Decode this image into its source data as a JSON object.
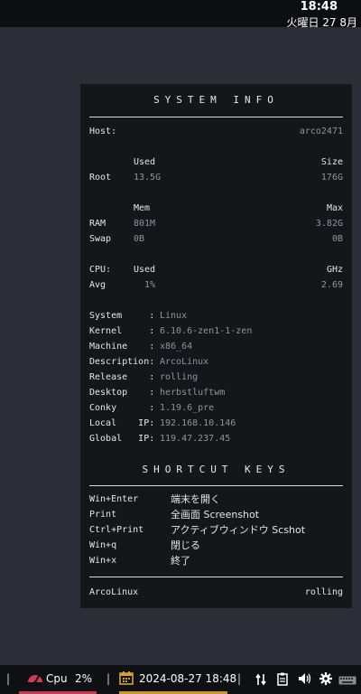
{
  "topbar": {
    "time": "18:48",
    "date": "火曜日 27 8月"
  },
  "conky": {
    "system_title": "SYSTEM INFO",
    "host_label": "Host:",
    "host_value": "arco2471",
    "disk": {
      "used_header": "Used",
      "size_header": "Size",
      "label": "Root",
      "used": "13.5G",
      "size": "176G"
    },
    "mem": {
      "mem_header": "Mem",
      "max_header": "Max",
      "ram_label": "RAM",
      "ram_used": "801M",
      "ram_max": "3.82G",
      "swap_label": "Swap",
      "swap_used": "0B",
      "swap_max": "0B"
    },
    "cpu": {
      "label": "CPU:",
      "used_header": "Used",
      "ghz_header": "GHz",
      "avg_label": "Avg",
      "avg_used": "1%",
      "avg_ghz": "2.69"
    },
    "info": [
      {
        "label": "System     :",
        "value": "Linux"
      },
      {
        "label": "Kernel     :",
        "value": "6.10.6-zen1-1-zen"
      },
      {
        "label": "Machine    :",
        "value": "x86_64"
      },
      {
        "label": "Description:",
        "value": "ArcoLinux"
      },
      {
        "label": "Release    :",
        "value": "rolling"
      },
      {
        "label": "Desktop    :",
        "value": "herbstluftwm"
      },
      {
        "label": "Conky      :",
        "value": "1.19.6_pre"
      },
      {
        "label": "Local    IP:",
        "value": "192.168.10.146"
      },
      {
        "label": "Global   IP:",
        "value": "119.47.237.45"
      }
    ],
    "shortcut_title": "SHORTCUT KEYS",
    "shortcuts": [
      {
        "key": "Win+Enter",
        "action": "端末を開く"
      },
      {
        "key": "Print",
        "action": "全画面 Screenshot"
      },
      {
        "key": "Ctrl+Print",
        "action": "アクティブウィンドウ Scshot"
      },
      {
        "key": "Win+q",
        "action": "閉じる"
      },
      {
        "key": "Win+x",
        "action": "終了"
      }
    ],
    "footer_left": "ArcoLinux",
    "footer_right": "rolling"
  },
  "taskbar": {
    "sep": "|",
    "cpu_label": "Cpu",
    "cpu_value": "2%",
    "datetime": "2024-08-27 18:48",
    "icons": [
      "network-icon",
      "clipboard-icon",
      "volume-icon",
      "gear-icon",
      "keyboard-icon"
    ],
    "colors": {
      "cpu_accent": "#c43a57",
      "date_accent": "#c79a2a"
    }
  }
}
